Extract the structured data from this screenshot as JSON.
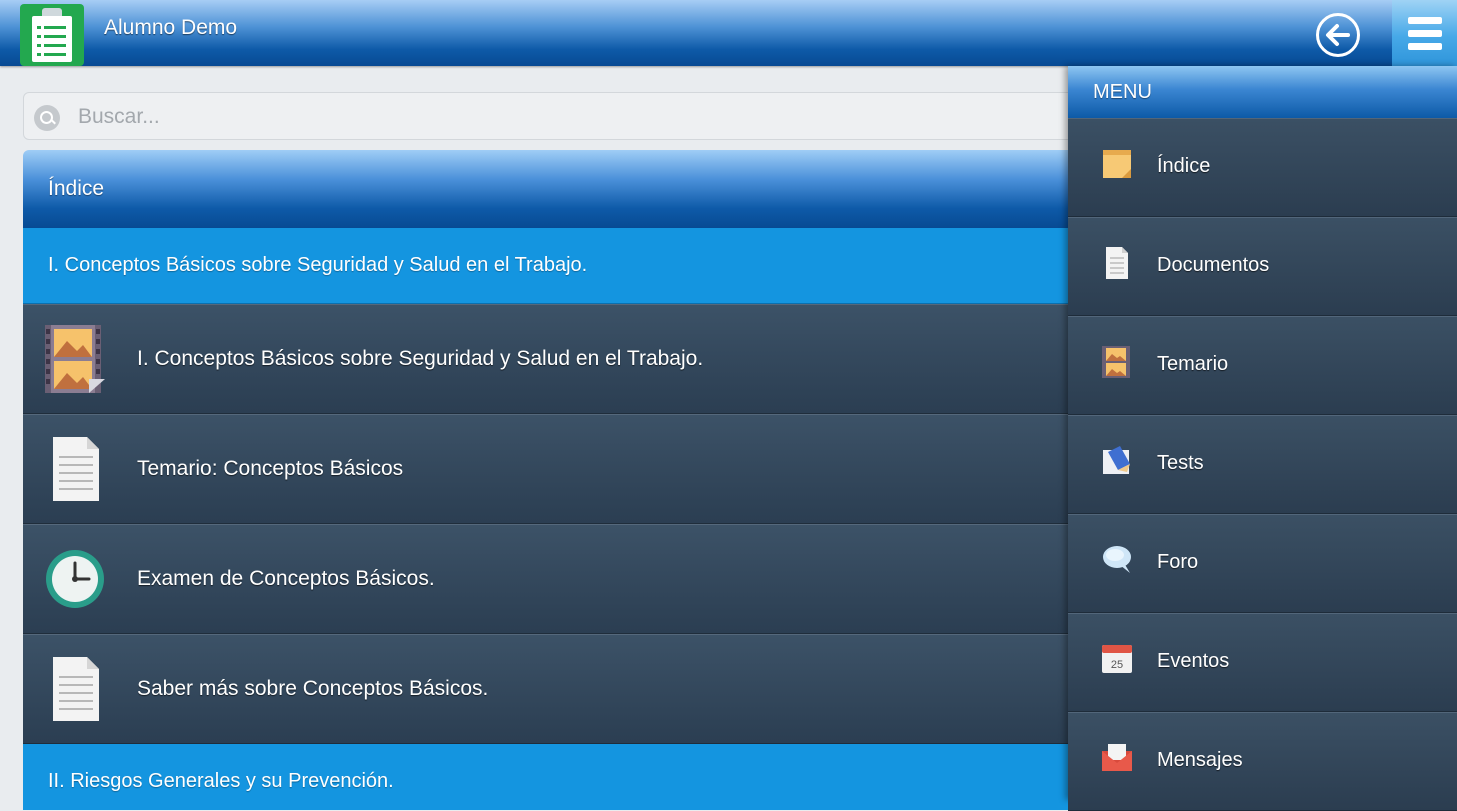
{
  "header": {
    "user_name": "Alumno Demo",
    "icons": [
      "clipboard-list-icon",
      "back-arrow-icon",
      "hamburger-menu-icon"
    ]
  },
  "search": {
    "placeholder": "Buscar..."
  },
  "list": {
    "title": "Índice",
    "sections": [
      {
        "title": "I. Conceptos Básicos sobre Seguridad y Salud en el Trabajo.",
        "items": [
          {
            "label": "I. Conceptos Básicos sobre Seguridad y Salud en el Trabajo.",
            "icon": "film-image-icon"
          },
          {
            "label": "Temario: Conceptos Básicos",
            "icon": "document-icon"
          },
          {
            "label": "Examen de Conceptos Básicos.",
            "icon": "clock-icon"
          },
          {
            "label": "Saber más sobre Conceptos Básicos.",
            "icon": "document-icon"
          }
        ]
      },
      {
        "title": "II. Riesgos Generales y su Prevención.",
        "items": []
      }
    ]
  },
  "menu": {
    "title": "MENU",
    "items": [
      {
        "label": "Índice",
        "icon": "notepad-icon"
      },
      {
        "label": "Documentos",
        "icon": "document-icon"
      },
      {
        "label": "Temario",
        "icon": "film-image-icon"
      },
      {
        "label": "Tests",
        "icon": "pencil-paper-icon"
      },
      {
        "label": "Foro",
        "icon": "speech-bubble-icon"
      },
      {
        "label": "Eventos",
        "icon": "calendar-icon",
        "calendar_day": "25"
      },
      {
        "label": "Mensajes",
        "icon": "envelope-icon"
      }
    ]
  },
  "colors": {
    "header_blue": "#0e5aa8",
    "section_blue": "#1495e0",
    "row_dark": "#2f4357",
    "accent_light": "#47a9e8"
  }
}
